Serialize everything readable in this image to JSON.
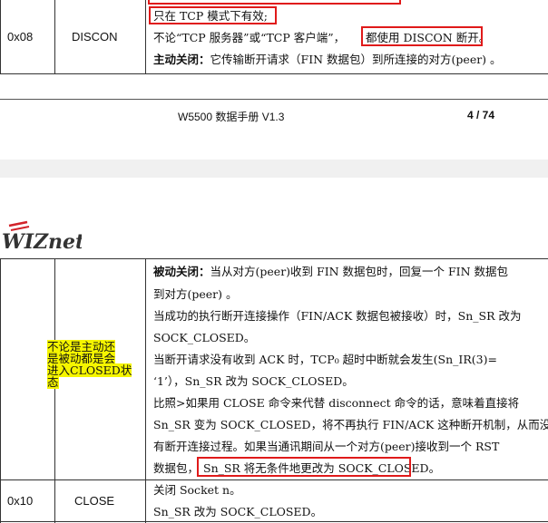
{
  "top_section": {
    "row_code": "0x08",
    "row_name": "DISCON",
    "line1": "只在 TCP 模式下有效;",
    "line2_a": "不论“TCP 服务器”或“TCP 客户端”，",
    "line2_b": "都使用 DISCON 断开。",
    "line3_bold": "主动关闭：",
    "line3_rest": "它传输断开请求（FIN 数据包）到所连接的对方(peer) 。"
  },
  "footer": {
    "title": "W5500 数据手册  V1.3",
    "page": "4 / 74"
  },
  "logo": {
    "text": "WIZnet"
  },
  "bottom_section": {
    "annotation": "不论是主动还是被动都是会进入CLOSED状态",
    "annotation_lines": [
      "不论是主动还",
      "是被动都是会",
      "进入CLOSED状",
      "态"
    ],
    "p1_bold": "被动关闭：",
    "p1_rest": "当从对方(peer)收到 FIN 数据包时，回复一个 FIN 数据包",
    "p1_line2": "到对方(peer) 。",
    "p2_line1": "当成功的执行断开连接操作（FIN/ACK 数据包被接收）时，Sn_SR 改为",
    "p2_line2": "SOCK_CLOSED。",
    "p3_line1": "当断开请求没有收到 ACK 时，TCP₀ 超时中断就会发生(Sn_IR(3)=",
    "p3_line2": "‘1’），Sn_SR 改为 SOCK_CLOSED。",
    "p4_line1": "比照>如果用 CLOSE 命令来代替 disconnect 命令的话，意味着直接将",
    "p4_line2": "Sn_SR 变为 SOCK_CLOSED，将不再执行 FIN/ACK 这种断开机制，从而没",
    "p4_line3": "有断开连接过程。如果当通讯期间从一个对方(peer)接收到一个 RST",
    "p4_line4_a": "数据包，",
    "p4_line4_b": "Sn_SR 将无条件地更改为 SOCK_CLOSED。",
    "close_code": "0x10",
    "close_name": "CLOSE",
    "close_line1": "关闭 Socket n。",
    "close_line2": "Sn_SR 改为 SOCK_CLOSED。"
  },
  "colors": {
    "highlight": "#f5f500",
    "box_red": "#e01a1a",
    "gap_gray": "#f0f0f0",
    "logo_red": "#d2232a",
    "logo_dark": "#333333"
  }
}
